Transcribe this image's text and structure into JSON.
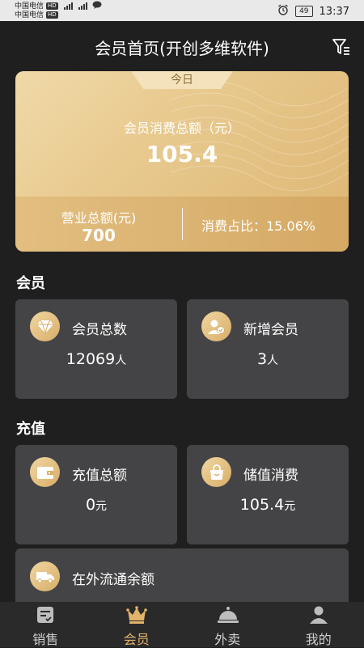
{
  "status_bar": {
    "carrier1": "中国电信",
    "carrier2": "中国电信",
    "hd": "HD",
    "battery": "49",
    "time": "13:37"
  },
  "header": {
    "title": "会员首页(开创多维软件)"
  },
  "summary": {
    "tab": "今日",
    "consume_label": "会员消费总额（元）",
    "consume_amount": "105.4",
    "revenue_label": "营业总额(元)",
    "revenue_value": "700",
    "ratio_text": "消费占比：15.06%"
  },
  "member_section": {
    "title": "会员",
    "total": {
      "label": "会员总数",
      "value": "12069",
      "unit": "人"
    },
    "new": {
      "label": "新增会员",
      "value": "3",
      "unit": "人"
    }
  },
  "recharge_section": {
    "title": "充值",
    "total": {
      "label": "充值总额",
      "value": "0",
      "unit": "元"
    },
    "stored": {
      "label": "储值消费",
      "value": "105.4",
      "unit": "元"
    },
    "circulation": {
      "label": "在外流通余额"
    }
  },
  "nav": {
    "items": [
      {
        "label": "销售",
        "icon": "clipboard-icon"
      },
      {
        "label": "会员",
        "icon": "crown-icon"
      },
      {
        "label": "外卖",
        "icon": "cloche-icon"
      },
      {
        "label": "我的",
        "icon": "person-icon"
      }
    ],
    "active_color": "#e2b46a"
  }
}
